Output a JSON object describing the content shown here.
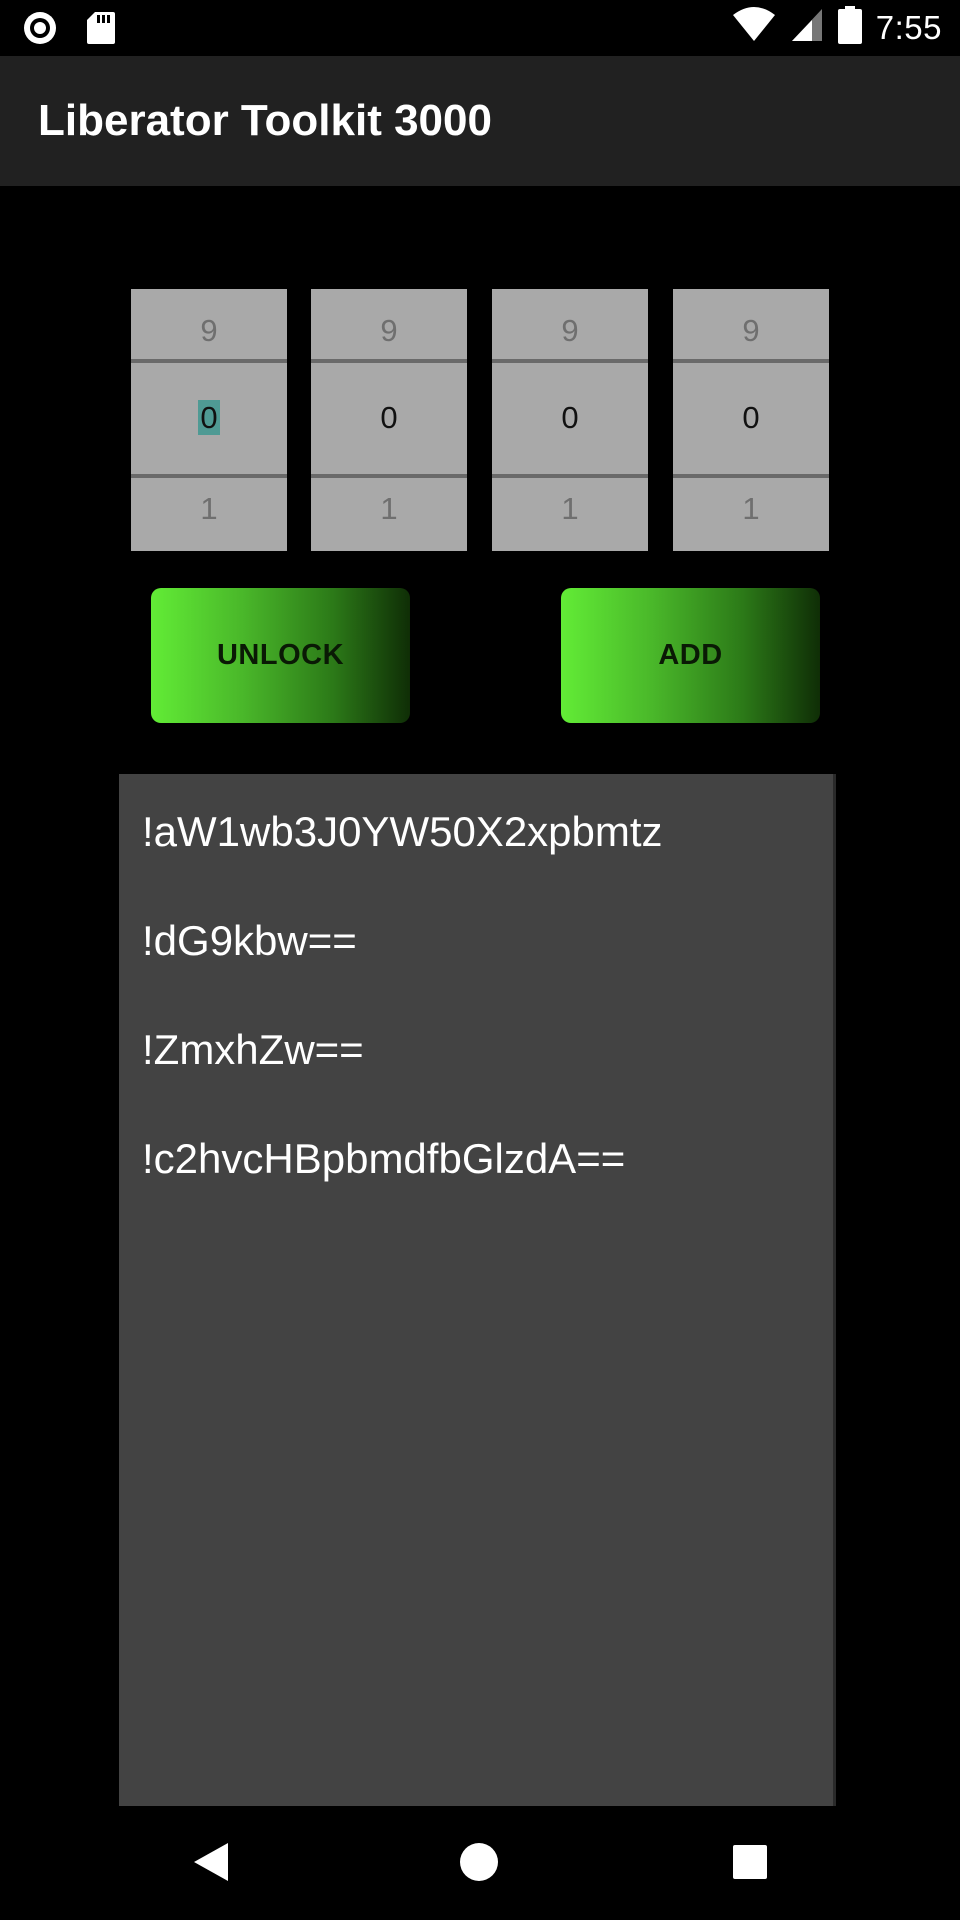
{
  "status_bar": {
    "time": "7:55",
    "icons": [
      "record-icon",
      "sd-card-icon",
      "wifi-icon",
      "signal-icon",
      "battery-icon"
    ]
  },
  "app_bar": {
    "title": "Liberator Toolkit 3000"
  },
  "pickers": [
    {
      "above": "9",
      "current": "0",
      "below": "1",
      "focused": true
    },
    {
      "above": "9",
      "current": "0",
      "below": "1",
      "focused": false
    },
    {
      "above": "9",
      "current": "0",
      "below": "1",
      "focused": false
    },
    {
      "above": "9",
      "current": "0",
      "below": "1",
      "focused": false
    }
  ],
  "buttons": {
    "unlock_label": "UNLOCK",
    "add_label": "ADD"
  },
  "log": {
    "lines": [
      "!aW1wb3J0YW50X2xpbmtz",
      "!dG9kbw==",
      "!ZmxhZw==",
      "!c2hvcHBpbmdfbGlzdA=="
    ]
  },
  "nav_bar": {
    "icons": [
      "back-icon",
      "home-icon",
      "recents-icon"
    ]
  },
  "colors": {
    "background": "#000000",
    "app_bar": "#212121",
    "picker": "#a9a9a9",
    "log_box": "#434343",
    "button_gradient_start": "#62ec36",
    "button_gradient_end": "#0f2e06",
    "selection_highlight": "#4f9a94"
  }
}
